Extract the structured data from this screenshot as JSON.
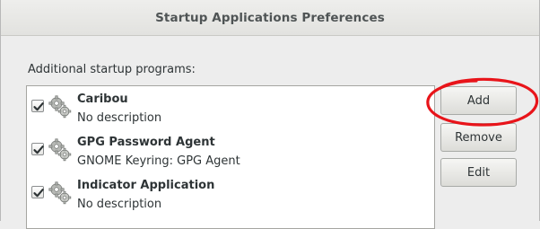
{
  "window": {
    "title": "Startup Applications Preferences"
  },
  "section_label": "Additional startup programs:",
  "programs": [
    {
      "name": "Caribou",
      "description": "No description",
      "checked": true,
      "icon": "gears-icon"
    },
    {
      "name": "GPG Password Agent",
      "description": "GNOME Keyring: GPG Agent",
      "checked": true,
      "icon": "gears-icon"
    },
    {
      "name": "Indicator Application",
      "description": "No description",
      "checked": true,
      "icon": "gears-icon"
    }
  ],
  "buttons": {
    "add_label": "Add",
    "remove_label": "Remove",
    "edit_label": "Edit"
  },
  "annotation": {
    "shape": "circle",
    "color": "#e8141a",
    "target": "add-button"
  }
}
